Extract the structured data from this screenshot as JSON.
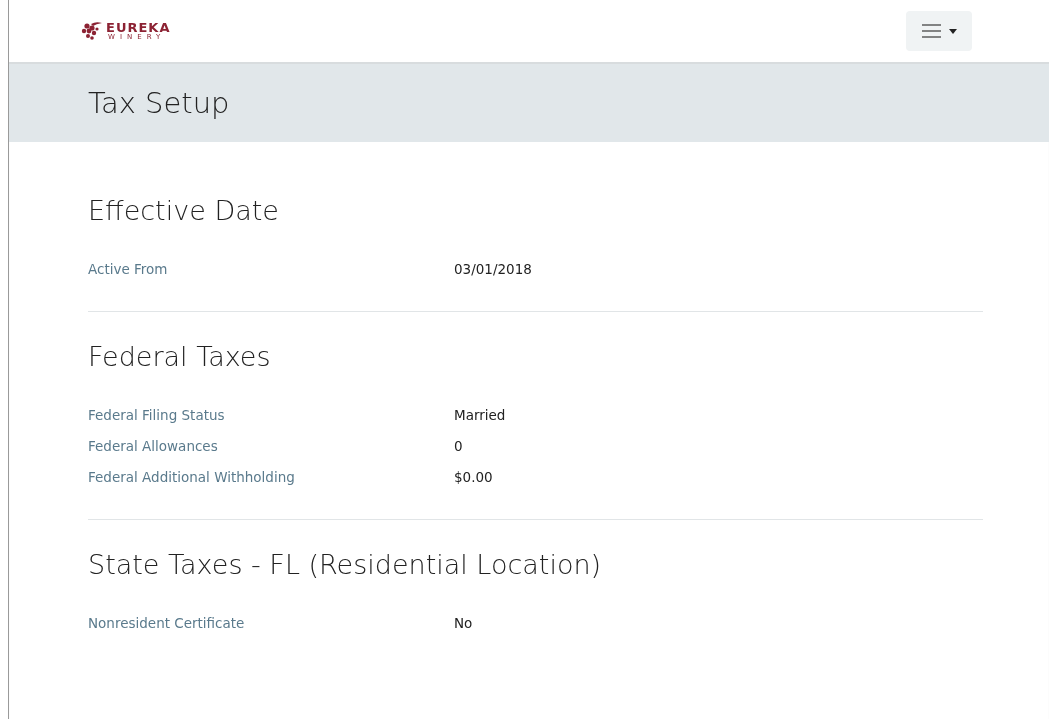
{
  "header": {
    "logo": {
      "name": "EUREKA",
      "tagline": "WINERY"
    },
    "menu_button": {
      "expanded": false
    }
  },
  "page_title": "Tax Setup",
  "sections": [
    {
      "title": "Effective Date",
      "fields": [
        {
          "label": "Active From",
          "value": "03/01/2018"
        }
      ]
    },
    {
      "title": "Federal Taxes",
      "fields": [
        {
          "label": "Federal Filing Status",
          "value": "Married"
        },
        {
          "label": "Federal Allowances",
          "value": "0"
        },
        {
          "label": "Federal Additional Withholding",
          "value": "$0.00"
        }
      ]
    },
    {
      "title": "State Taxes - FL (Residential Location)",
      "fields": [
        {
          "label": "Nonresident Certificate",
          "value": "No"
        }
      ]
    }
  ]
}
